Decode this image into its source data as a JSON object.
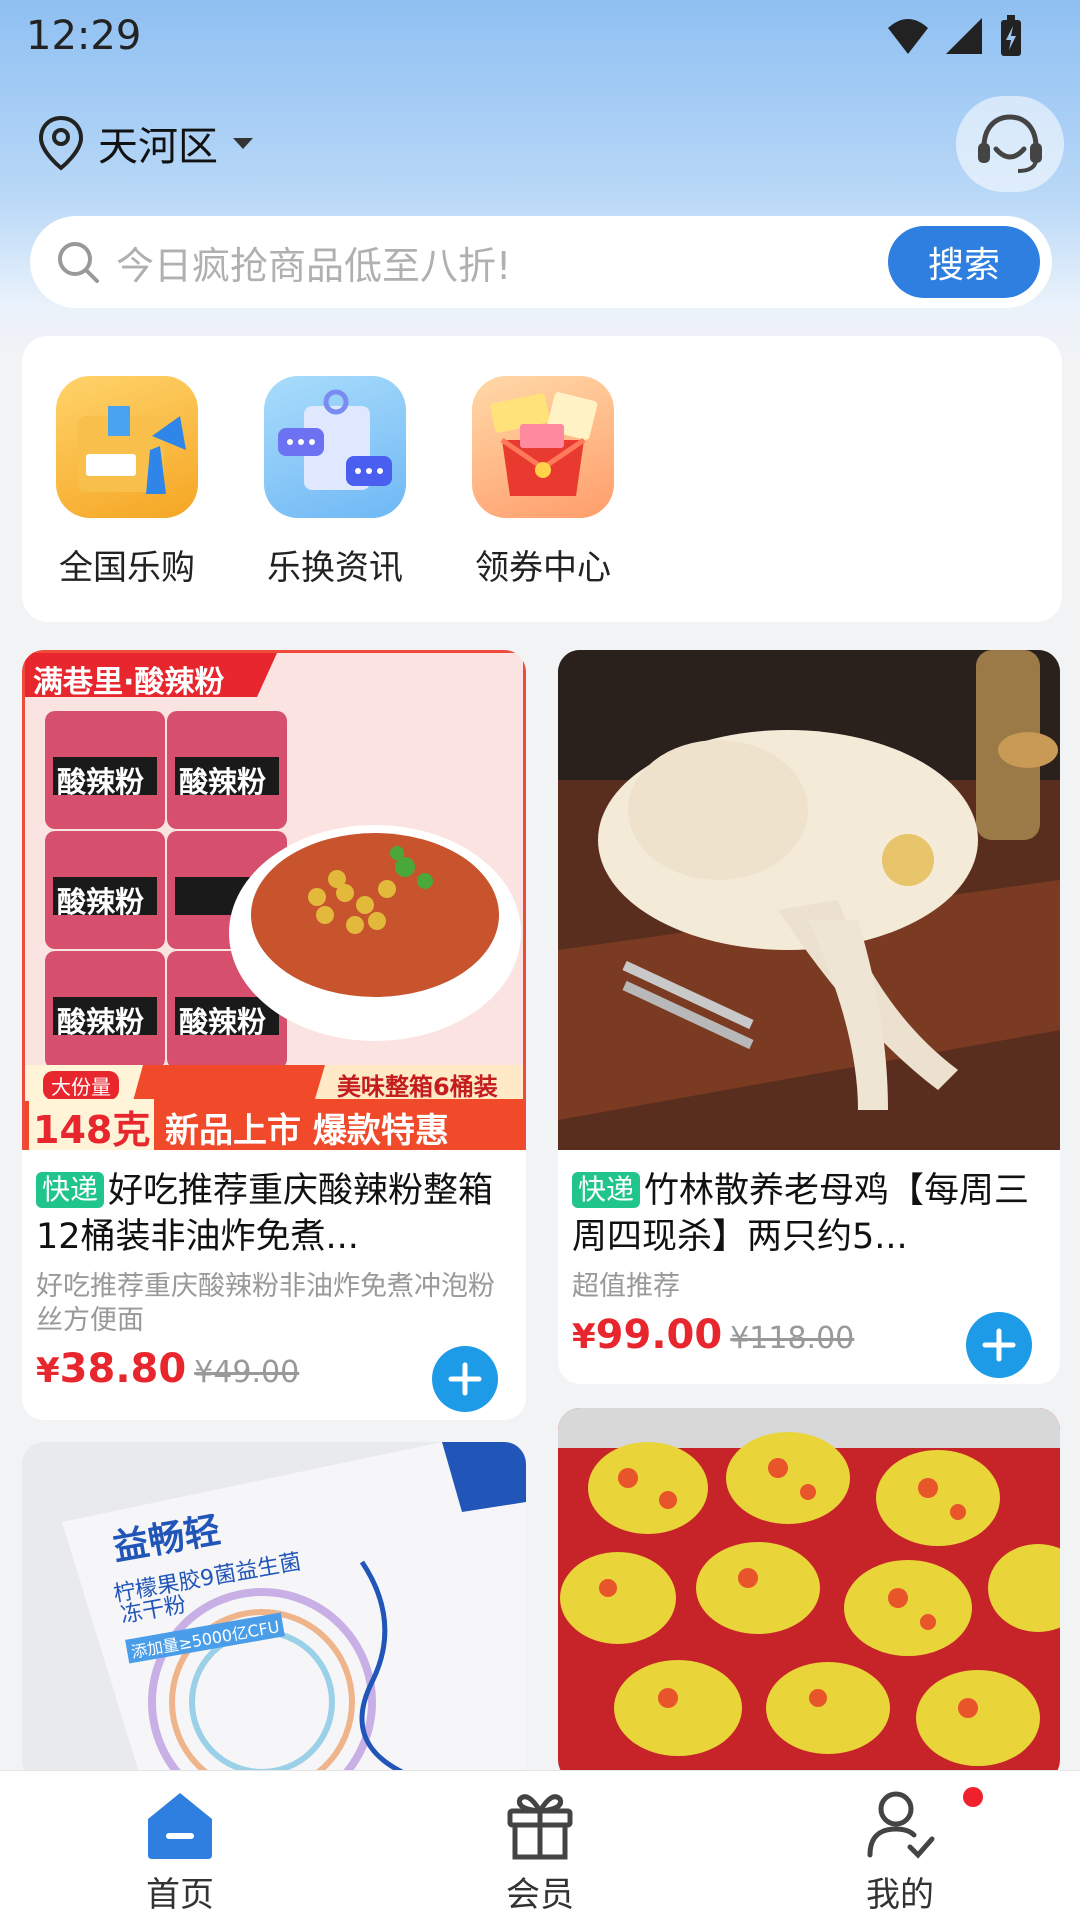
{
  "status_bar": {
    "time": "12:29"
  },
  "header": {
    "location": "天河区",
    "search_placeholder": "今日疯抢商品低至八折!",
    "search_button": "搜索"
  },
  "quick_links": [
    {
      "label": "全国乐购",
      "icon": "package-icon"
    },
    {
      "label": "乐换资讯",
      "icon": "chat-clipboard-icon"
    },
    {
      "label": "领券中心",
      "icon": "coupon-icon"
    }
  ],
  "products": [
    {
      "tag": "快递",
      "title": "好吃推荐重庆酸辣粉整箱12桶装非油炸免煮...",
      "desc": "好吃推荐重庆酸辣粉非油炸免煮冲泡粉丝方便面",
      "price": "38.80",
      "original_price": "¥49.00",
      "currency": "¥",
      "image": {
        "banner": "满巷里·酸辣粉",
        "cup_text": "酸辣粉",
        "badge_top": "大份量",
        "badge_weight": "148克",
        "ribbon": "美味整箱6桶装",
        "bottom_text": "新品上市 爆款特惠"
      }
    },
    {
      "tag": "快递",
      "title": "竹林散养老母鸡【每周三周四现杀】两只约5...",
      "desc": "超值推荐",
      "price": "99.00",
      "original_price": "¥118.00",
      "currency": "¥"
    },
    {
      "image": {
        "brand": "益畅轻",
        "line1": "柠檬果胶9菌益生菌",
        "line2": "冻干粉",
        "line3": "添加量≥5000亿CFU"
      }
    },
    {}
  ],
  "bottom_nav": [
    {
      "label": "首页",
      "icon": "home-icon",
      "active": true
    },
    {
      "label": "会员",
      "icon": "gift-icon"
    },
    {
      "label": "我的",
      "icon": "user-icon"
    }
  ],
  "colors": {
    "accent": "#2e7fe0",
    "price": "#e8262d",
    "tag": "#1fc58a",
    "add_button": "#1d9be6"
  }
}
